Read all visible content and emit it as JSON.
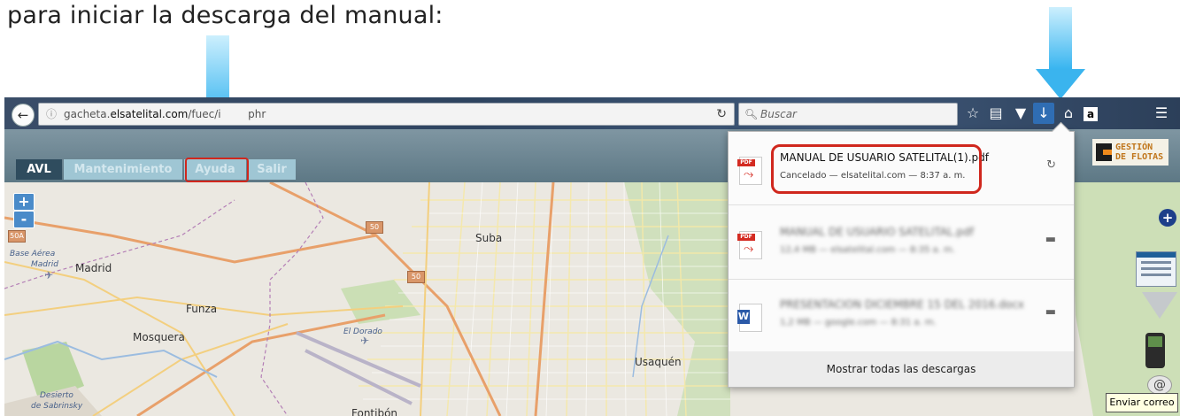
{
  "caption": "para iniciar la descarga del manual:",
  "browser": {
    "url_prefix": "gacheta.",
    "url_domain": "elsatelital.com",
    "url_path": "/fuec/i",
    "url_hidden_tail": "phr",
    "search_placeholder": "Buscar"
  },
  "page": {
    "tabs": [
      "AVL",
      "Mantenimiento",
      "Ayuda",
      "Salir"
    ],
    "logo_text_line1": "GESTIÓN",
    "logo_text_line2": "DE FLOTAS"
  },
  "map": {
    "labels": [
      "Suba",
      "Madrid",
      "Funza",
      "Mosquera",
      "Usaquén",
      "Fontibón"
    ],
    "italic_labels": [
      "Base Aérea",
      "Madrid",
      "El Dorado",
      "Desierto",
      "de Sabrinsky"
    ],
    "shields": [
      "50",
      "50",
      "50A"
    ],
    "zoom_in": "+",
    "zoom_out": "-"
  },
  "downloads": {
    "items": [
      {
        "name": "MANUAL DE USUARIO SATELITAL(1).pdf",
        "status": "Cancelado — elsatelital.com — 8:37 a. m.",
        "type": "pdf",
        "action_icon": "retry-icon"
      },
      {
        "name": "MANUAL DE USUARIO SATELITAL.pdf",
        "status": "12,4 MB — elsatelital.com — 8:35 a. m.",
        "type": "pdf",
        "action_icon": "folder-icon"
      },
      {
        "name": "PRESENTACION DICIEMBRE 15 DEL 2016.docx",
        "status": "1,2 MB — google.com — 8:31 a. m.",
        "type": "word",
        "action_icon": "folder-icon"
      }
    ],
    "show_all": "Mostrar todas las descargas"
  },
  "tooltip": "Enviar correo",
  "colors": {
    "arrow": "#3ab4ee",
    "highlight": "#d0271d",
    "tab_active": "#2f4c5e",
    "tab_inactive": "#9fc6d4"
  }
}
